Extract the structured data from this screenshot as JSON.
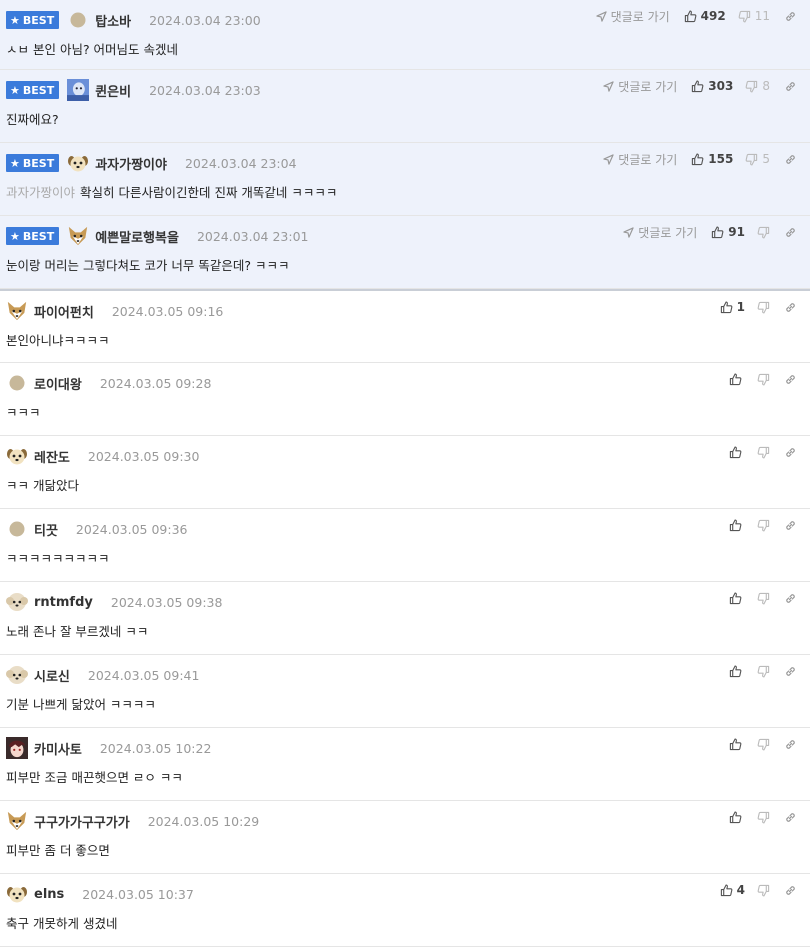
{
  "labels": {
    "best": "BEST",
    "goto_reply": "댓글로 가기"
  },
  "colors": {
    "best_bg": "#eef2fb",
    "badge": "#3b7bdb",
    "date": "#999999",
    "mention": "#aaaaaa"
  },
  "comments": [
    {
      "best": true,
      "avatar": "dot-icon",
      "nickname": "탑소바",
      "date": "2024.03.04 23:00",
      "mention": "",
      "text": "ㅅㅂ 본인 아님? 어머님도 속겠네",
      "likes": "492",
      "dislikes": "11"
    },
    {
      "best": true,
      "avatar": "photo-icon",
      "nickname": "퀸은비",
      "date": "2024.03.04 23:03",
      "mention": "",
      "text": "진짜에요?",
      "likes": "303",
      "dislikes": "8"
    },
    {
      "best": true,
      "avatar": "puppy-icon",
      "nickname": "과자가짱이야",
      "date": "2024.03.04 23:04",
      "mention": "과자가짱이야",
      "text": "확실히 다른사람이긴한데 진짜 개똑같네 ㅋㅋㅋㅋ",
      "likes": "155",
      "dislikes": "5"
    },
    {
      "best": true,
      "avatar": "fox-icon",
      "nickname": "예쁜말로행복을",
      "date": "2024.03.04 23:01",
      "mention": "",
      "text": "눈이랑 머리는 그렇다쳐도 코가 너무 똑같은데? ㅋㅋㅋ",
      "likes": "91",
      "dislikes": ""
    },
    {
      "best": false,
      "avatar": "fox-icon",
      "nickname": "파이어펀치",
      "date": "2024.03.05 09:16",
      "mention": "",
      "text": "본인아니냐ㅋㅋㅋㅋ",
      "likes": "1",
      "dislikes": ""
    },
    {
      "best": false,
      "avatar": "dot-icon",
      "nickname": "로이대왕",
      "date": "2024.03.05 09:28",
      "mention": "",
      "text": "ㅋㅋㅋ",
      "likes": "",
      "dislikes": ""
    },
    {
      "best": false,
      "avatar": "puppy-icon",
      "nickname": "레잔도",
      "date": "2024.03.05 09:30",
      "mention": "",
      "text": "ㅋㅋ 개닮았다",
      "likes": "",
      "dislikes": ""
    },
    {
      "best": false,
      "avatar": "dot-icon",
      "nickname": "티끗",
      "date": "2024.03.05 09:36",
      "mention": "",
      "text": "ㅋㅋㅋㅋㅋㅋㅋㅋㅋ",
      "likes": "",
      "dislikes": ""
    },
    {
      "best": false,
      "avatar": "fluffy-icon",
      "nickname": "rntmfdy",
      "date": "2024.03.05 09:38",
      "mention": "",
      "text": "노래 존나 잘 부르겠네 ㅋㅋ",
      "likes": "",
      "dislikes": ""
    },
    {
      "best": false,
      "avatar": "fluffy-icon",
      "nickname": "시로신",
      "date": "2024.03.05 09:41",
      "mention": "",
      "text": "기분 나쁘게 닮았어 ㅋㅋㅋㅋ",
      "likes": "",
      "dislikes": ""
    },
    {
      "best": false,
      "avatar": "anime-icon",
      "nickname": "카미사토",
      "date": "2024.03.05 10:22",
      "mention": "",
      "text": "피부만 조금 매끈햇으면 ㄹㅇ ㅋㅋ",
      "likes": "",
      "dislikes": ""
    },
    {
      "best": false,
      "avatar": "fox-icon",
      "nickname": "구구가가구구가가",
      "date": "2024.03.05 10:29",
      "mention": "",
      "text": "피부만 좀 더 좋으면",
      "likes": "",
      "dislikes": ""
    },
    {
      "best": false,
      "avatar": "puppy-icon",
      "nickname": "elns",
      "date": "2024.03.05 10:37",
      "mention": "",
      "text": "축구 개못하게 생겼네",
      "likes": "4",
      "dislikes": ""
    }
  ]
}
